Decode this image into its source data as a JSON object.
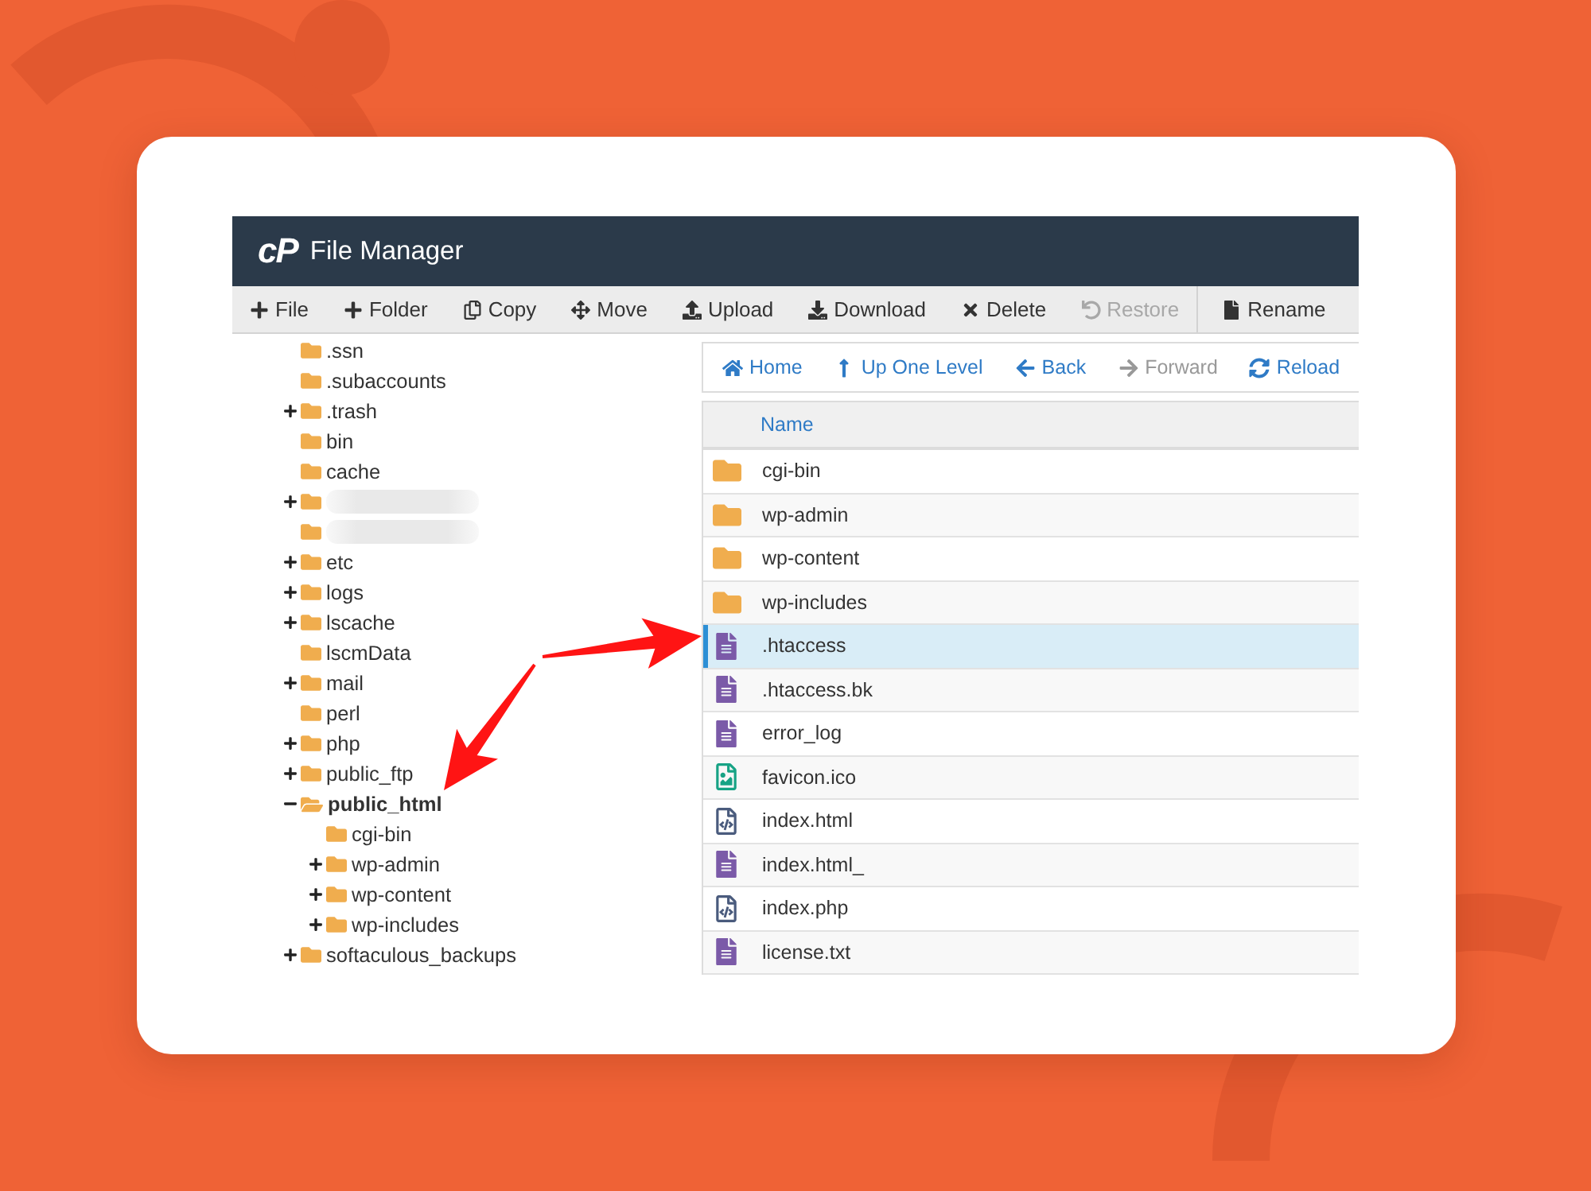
{
  "window": {
    "logo": "cP",
    "title": "File Manager"
  },
  "toolbar": {
    "groups": [
      [
        {
          "label": "File",
          "disabled": false
        },
        {
          "label": "Folder",
          "disabled": false
        },
        {
          "label": "Copy",
          "disabled": false
        },
        {
          "label": "Move",
          "disabled": false
        },
        {
          "label": "Upload",
          "disabled": false
        },
        {
          "label": "Download",
          "disabled": false
        },
        {
          "label": "Delete",
          "disabled": false
        },
        {
          "label": "Restore",
          "disabled": true
        }
      ],
      [
        {
          "label": "Rename",
          "disabled": false
        }
      ]
    ]
  },
  "folder_tree": [
    {
      "label": ".ssn",
      "redacted": false,
      "expandable": false,
      "expanded": false,
      "selected": false
    },
    {
      "label": ".subaccounts",
      "redacted": false,
      "expandable": false,
      "expanded": false,
      "selected": false
    },
    {
      "label": ".trash",
      "redacted": false,
      "expandable": true,
      "expanded": false,
      "selected": false
    },
    {
      "label": "bin",
      "redacted": false,
      "expandable": false,
      "expanded": false,
      "selected": false
    },
    {
      "label": "cache",
      "redacted": false,
      "expandable": false,
      "expanded": false,
      "selected": false
    },
    {
      "redacted": true,
      "expandable": true,
      "expanded": false,
      "selected": false
    },
    {
      "redacted": true,
      "expandable": false,
      "expanded": false,
      "selected": false
    },
    {
      "label": "etc",
      "redacted": false,
      "expandable": true,
      "expanded": false,
      "selected": false
    },
    {
      "label": "logs",
      "redacted": false,
      "expandable": true,
      "expanded": false,
      "selected": false
    },
    {
      "label": "lscache",
      "redacted": false,
      "expandable": true,
      "expanded": false,
      "selected": false
    },
    {
      "label": "lscmData",
      "redacted": false,
      "expandable": false,
      "expanded": false,
      "selected": false
    },
    {
      "label": "mail",
      "redacted": false,
      "expandable": true,
      "expanded": false,
      "selected": false
    },
    {
      "label": "perl",
      "redacted": false,
      "expandable": false,
      "expanded": false,
      "selected": false
    },
    {
      "label": "php",
      "redacted": false,
      "expandable": true,
      "expanded": false,
      "selected": false
    },
    {
      "label": "public_ftp",
      "redacted": false,
      "expandable": true,
      "expanded": false,
      "selected": false
    },
    {
      "label": "public_html",
      "redacted": false,
      "expandable": true,
      "expanded": true,
      "selected": true,
      "children": [
        {
          "label": "cgi-bin",
          "redacted": false,
          "expandable": false,
          "expanded": false,
          "selected": false
        },
        {
          "label": "wp-admin",
          "redacted": false,
          "expandable": true,
          "expanded": false,
          "selected": false
        },
        {
          "label": "wp-content",
          "redacted": false,
          "expandable": true,
          "expanded": false,
          "selected": false
        },
        {
          "label": "wp-includes",
          "redacted": false,
          "expandable": true,
          "expanded": false,
          "selected": false
        }
      ]
    },
    {
      "label": "softaculous_backups",
      "redacted": false,
      "expandable": true,
      "expanded": false,
      "selected": false
    }
  ],
  "navigation": [
    {
      "label": "Home",
      "disabled": false
    },
    {
      "label": "Up One Level",
      "disabled": false
    },
    {
      "label": "Back",
      "disabled": false
    },
    {
      "label": "Forward",
      "disabled": true
    },
    {
      "label": "Reload",
      "disabled": false
    }
  ],
  "file_table": {
    "columns": [
      "Name"
    ],
    "rows": [
      {
        "name": "cgi-bin",
        "kind": "folder",
        "selected": false
      },
      {
        "name": "wp-admin",
        "kind": "folder",
        "selected": false
      },
      {
        "name": "wp-content",
        "kind": "folder",
        "selected": false
      },
      {
        "name": "wp-includes",
        "kind": "folder",
        "selected": false
      },
      {
        "name": ".htaccess",
        "kind": "text",
        "selected": true
      },
      {
        "name": ".htaccess.bk",
        "kind": "text",
        "selected": false
      },
      {
        "name": "error_log",
        "kind": "text",
        "selected": false
      },
      {
        "name": "favicon.ico",
        "kind": "image",
        "selected": false
      },
      {
        "name": "index.html",
        "kind": "code",
        "selected": false
      },
      {
        "name": "index.html_",
        "kind": "text",
        "selected": false
      },
      {
        "name": "index.php",
        "kind": "code",
        "selected": false
      },
      {
        "name": "license.txt",
        "kind": "text",
        "selected": false
      }
    ]
  }
}
